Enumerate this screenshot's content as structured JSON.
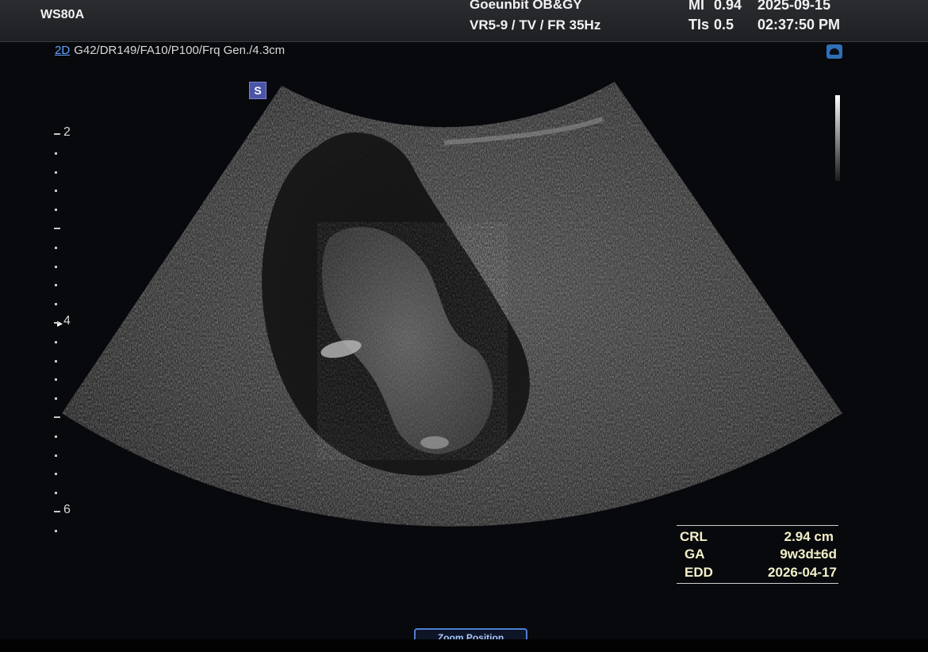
{
  "header": {
    "model": "WS80A",
    "hospital": "Goeunbit OB&GY",
    "preset": "VR5-9 / TV / FR 35Hz",
    "mi_label": "MI",
    "mi_value": "0.94",
    "tis_label": "TIs",
    "tis_value": "0.5",
    "date": "2025-09-15",
    "time": "02:37:50 PM"
  },
  "imaging": {
    "mode": "2D",
    "parameters": "G42/DR149/FA10/P100/Frq Gen./4.3cm",
    "orientation_marker": "S"
  },
  "depth_scale": {
    "labels": [
      "2",
      "4",
      "6"
    ]
  },
  "measurements": [
    {
      "label": "CRL",
      "value": "2.94 cm"
    },
    {
      "label": "GA",
      "value": "9w3d±6d"
    },
    {
      "label": "EDD",
      "value": "2026-04-17"
    }
  ],
  "controls": {
    "zoom_position": "Zoom Position"
  },
  "icons": {
    "probe": "probe-icon",
    "greyscale": "greyscale-bar-icon"
  }
}
